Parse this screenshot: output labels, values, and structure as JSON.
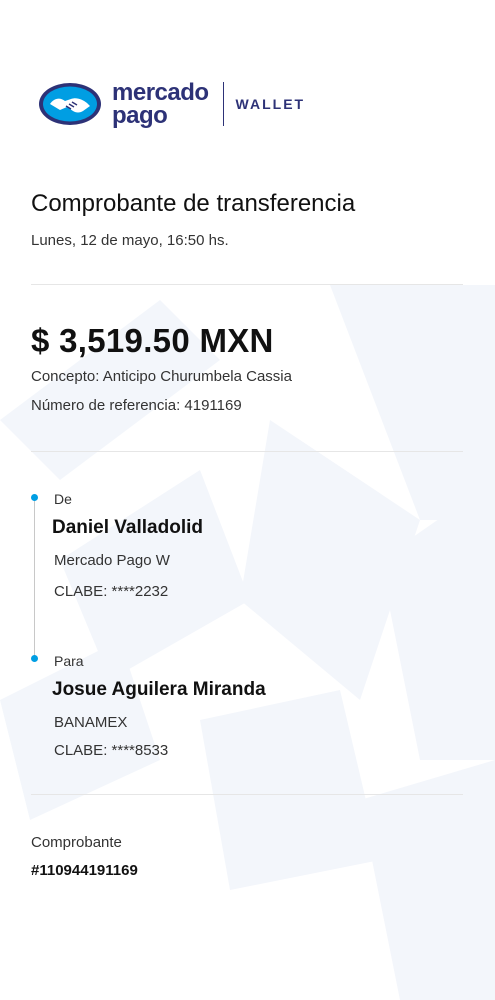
{
  "brand": {
    "name_line1": "mercado",
    "name_line2": "pago",
    "product": "WALLET",
    "colors": {
      "primary": "#2d3277",
      "accent": "#009ee3"
    },
    "icon": "handshake-logo"
  },
  "receipt": {
    "title": "Comprobante de transferencia",
    "date": "Lunes, 12 de mayo, 16:50 hs.",
    "amount": "$ 3,519.50 MXN",
    "concept": "Concepto: Anticipo Churumbela Cassia",
    "reference": "Número de referencia: 4191169"
  },
  "from": {
    "label": "De",
    "name": "Daniel Valladolid",
    "bank": "Mercado Pago W",
    "clabe": "CLABE: ****2232"
  },
  "to": {
    "label": "Para",
    "name": "Josue Aguilera Miranda",
    "bank": "BANAMEX",
    "clabe": "CLABE: ****8533"
  },
  "footer": {
    "label": "Comprobante",
    "number": "#110944191169"
  }
}
